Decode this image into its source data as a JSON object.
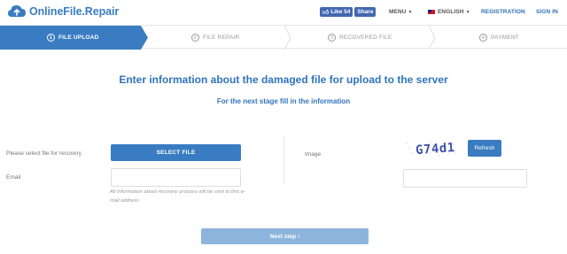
{
  "header": {
    "logo_text": "OnlineFile.Repair",
    "fb_like_label": "Like",
    "fb_like_count": "54",
    "fb_share_label": "Share",
    "menu_label": "MENU",
    "language_label": "ENGLISH",
    "registration_label": "REGISTRATION",
    "signin_label": "SIGN IN"
  },
  "steps": [
    {
      "num": "1",
      "label": "FILE UPLOAD",
      "active": true
    },
    {
      "num": "2",
      "label": "FILE REPAIR",
      "active": false
    },
    {
      "num": "3",
      "label": "RECOVERED FILE",
      "active": false
    },
    {
      "num": "4",
      "label": "PAYMENT",
      "active": false
    }
  ],
  "main": {
    "title": "Enter information about the damaged file for upload to the server",
    "subtitle": "For the next stage fill in the information",
    "file_label": "Please select file for recovery",
    "select_file_label": "SELECT FILE",
    "email_label": "Email",
    "email_value": "",
    "email_hint": "All information about recovery process will be sent to this e-mail address",
    "image_label": "Image",
    "captcha_text": "G74d1",
    "refresh_label": "Refresh",
    "captcha_value": "",
    "next_label": "Next step"
  },
  "colors": {
    "accent": "#3a7cc2",
    "accent_disabled": "#8db4dd",
    "title_blue": "#2f74bb"
  }
}
